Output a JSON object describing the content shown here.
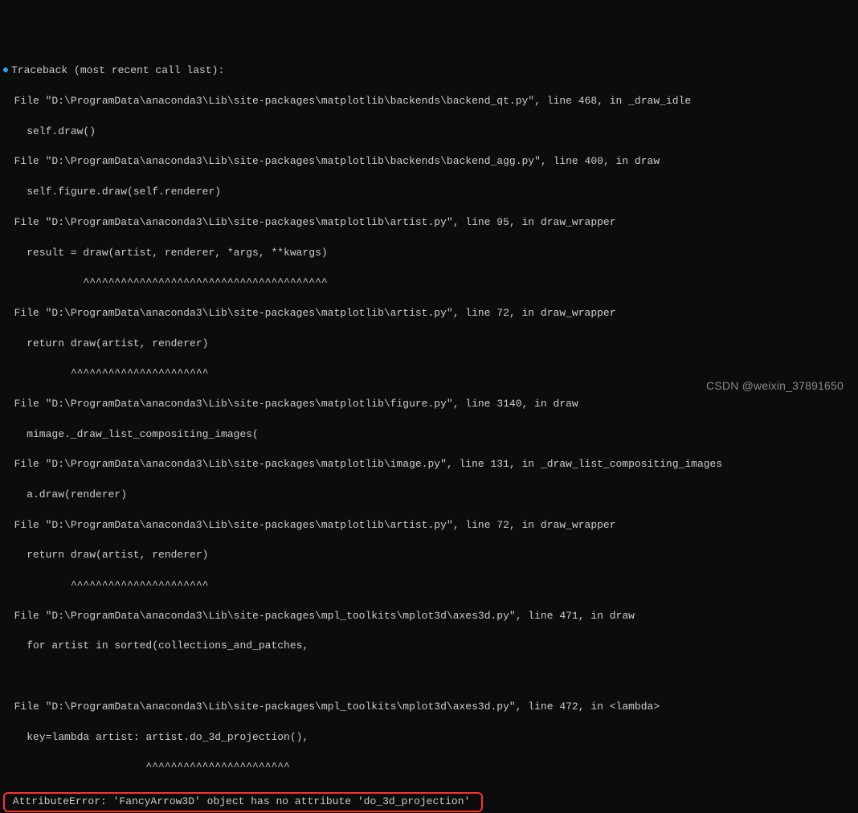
{
  "traceback": {
    "header": "Traceback (most recent call last):",
    "frames": [
      {
        "loc": "  File \"D:\\ProgramData\\anaconda3\\Lib\\site-packages\\matplotlib\\backends\\backend_qt.py\", line 468, in _draw_idle",
        "code": "    self.draw()",
        "caret": ""
      },
      {
        "loc": "  File \"D:\\ProgramData\\anaconda3\\Lib\\site-packages\\matplotlib\\backends\\backend_agg.py\", line 400, in draw",
        "code": "    self.figure.draw(self.renderer)",
        "caret": ""
      },
      {
        "loc": "  File \"D:\\ProgramData\\anaconda3\\Lib\\site-packages\\matplotlib\\artist.py\", line 95, in draw_wrapper",
        "code": "    result = draw(artist, renderer, *args, **kwargs)",
        "caret": "             ^^^^^^^^^^^^^^^^^^^^^^^^^^^^^^^^^^^^^^^"
      },
      {
        "loc": "  File \"D:\\ProgramData\\anaconda3\\Lib\\site-packages\\matplotlib\\artist.py\", line 72, in draw_wrapper",
        "code": "    return draw(artist, renderer)",
        "caret": "           ^^^^^^^^^^^^^^^^^^^^^^"
      },
      {
        "loc": "  File \"D:\\ProgramData\\anaconda3\\Lib\\site-packages\\matplotlib\\figure.py\", line 3140, in draw",
        "code": "    mimage._draw_list_compositing_images(",
        "caret": ""
      },
      {
        "loc": "  File \"D:\\ProgramData\\anaconda3\\Lib\\site-packages\\matplotlib\\image.py\", line 131, in _draw_list_compositing_images",
        "code": "    a.draw(renderer)",
        "caret": ""
      },
      {
        "loc": "  File \"D:\\ProgramData\\anaconda3\\Lib\\site-packages\\matplotlib\\artist.py\", line 72, in draw_wrapper",
        "code": "    return draw(artist, renderer)",
        "caret": "           ^^^^^^^^^^^^^^^^^^^^^^"
      },
      {
        "loc": "  File \"D:\\ProgramData\\anaconda3\\Lib\\site-packages\\mpl_toolkits\\mplot3d\\axes3d.py\", line 471, in draw",
        "code": "    for artist in sorted(collections_and_patches,",
        "caret": ""
      },
      {
        "loc": "  File \"D:\\ProgramData\\anaconda3\\Lib\\site-packages\\mpl_toolkits\\mplot3d\\axes3d.py\", line 472, in <lambda>",
        "code": "    key=lambda artist: artist.do_3d_projection(),",
        "caret": "                       ^^^^^^^^^^^^^^^^^^^^^^^"
      }
    ],
    "error": " AttributeError: 'FancyArrow3D' object has no attribute 'do_3d_projection' "
  },
  "watermark": "CSDN @weixin_37891650"
}
